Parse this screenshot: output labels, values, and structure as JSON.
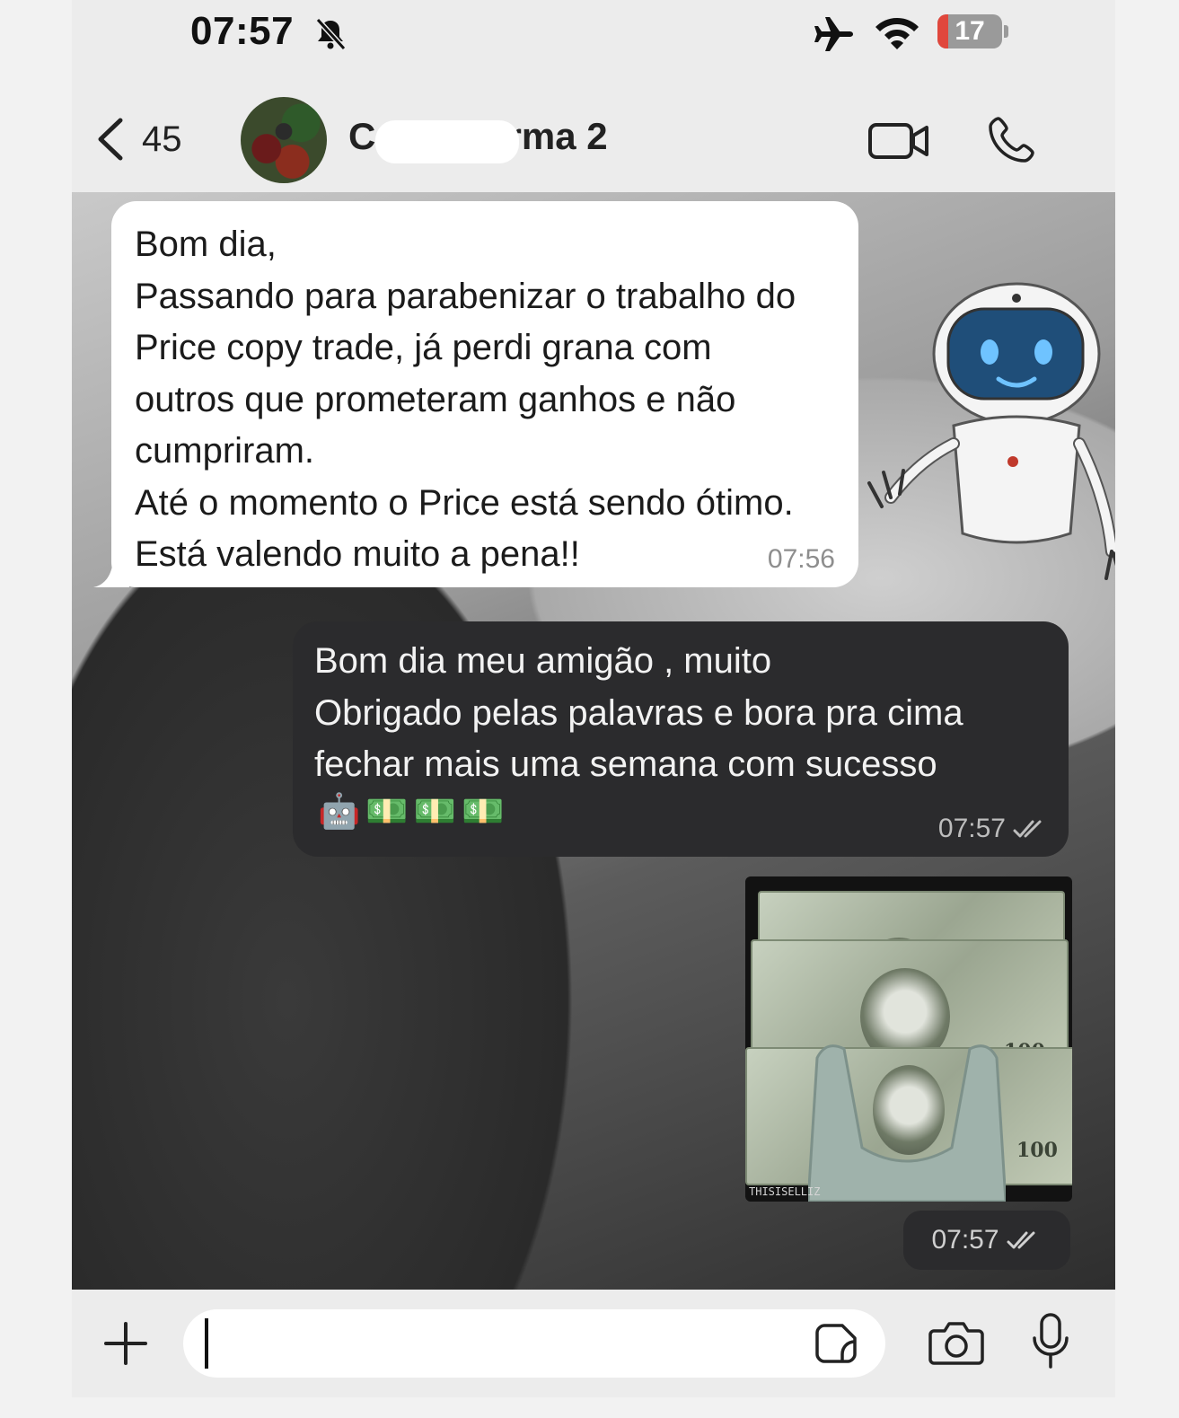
{
  "status_bar": {
    "time": "07:57",
    "battery": "17",
    "battery_level": 0.17,
    "icons": [
      "bell-slash-icon",
      "airplane-icon",
      "wifi-icon",
      "battery-icon"
    ]
  },
  "header": {
    "back_count": "45",
    "group_name": "C      opy Turma 2",
    "icons": [
      "chevron-left-icon",
      "video-camera-icon",
      "phone-icon"
    ]
  },
  "messages": [
    {
      "direction": "incoming",
      "text": "Bom dia,\nPassando para parabenizar o trabalho do\nPrice copy trade, já perdi grana com\noutros que prometeram ganhos e não\ncumpriram.\nAté o momento o Price está sendo ótimo.\nEstá valendo muito a pena!!",
      "time": "07:56"
    },
    {
      "direction": "outgoing",
      "text": "Bom dia meu amigão , muito\nObrigado pelas palavras e bora pra cima\nfechar mais uma semana com sucesso",
      "emoji": "🤖💵💵💵",
      "time": "07:57"
    },
    {
      "direction": "outgoing",
      "type": "media",
      "watermark": "THISISELLIZ",
      "time": "07:57"
    }
  ],
  "input_bar": {
    "icons": [
      "plus-icon",
      "sticker-icon",
      "camera-icon",
      "microphone-icon"
    ]
  },
  "colors": {
    "incoming_bubble": "#ffffff",
    "outgoing_bubble": "#2b2b2d",
    "battery_low": "#e0473c"
  }
}
